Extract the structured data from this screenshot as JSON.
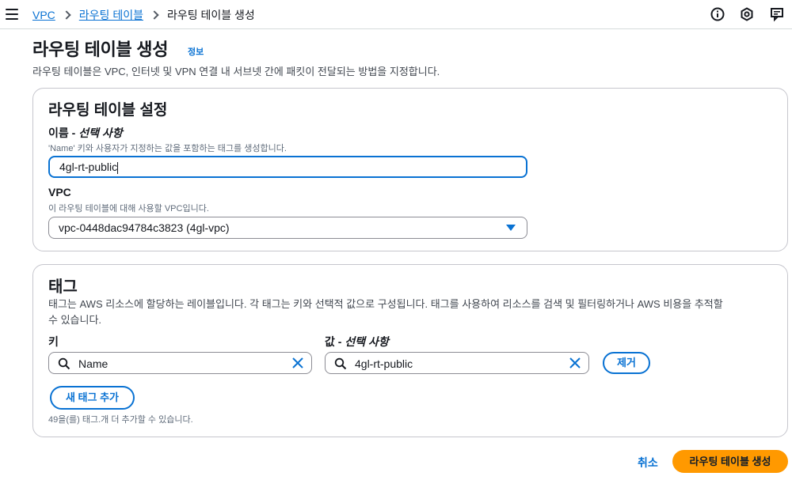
{
  "nav": {
    "breadcrumbs": [
      "VPC",
      "라우팅 테이블",
      "라우팅 테이블 생성"
    ]
  },
  "header": {
    "title": "라우팅 테이블 생성",
    "info": "정보",
    "description": "라우팅 테이블은 VPC, 인터넷 및 VPN 연결 내 서브넷 간에 패킷이 전달되는 방법을 지정합니다."
  },
  "settings": {
    "title": "라우팅 테이블 설정",
    "name_label": "이름 - ",
    "name_optional": "선택 사항",
    "name_desc": "'Name' 키와 사용자가 지정하는 값을 포함하는 태그를 생성합니다.",
    "name_value": "4gl-rt-public",
    "vpc_label": "VPC",
    "vpc_desc": "이 라우팅 테이블에 대해 사용할 VPC입니다.",
    "vpc_selected": "vpc-0448dac94784c3823 (4gl-vpc)"
  },
  "tags": {
    "title": "태그",
    "desc_line1": "태그는 AWS 리소스에 할당하는 레이블입니다. 각 태그는 키와 선택적 값으로 구성됩니다. 태그를 사용하여 리소스를 검색 및 필터링하거나 AWS 비용을 추적할",
    "desc_line2": "수 있습니다.",
    "key_label": "키",
    "value_label": "값 - ",
    "value_optional": "선택 사항",
    "key_value": "Name",
    "tag_value": "4gl-rt-public",
    "remove_label": "제거",
    "add_label": "새 태그 추가",
    "limit_text": "49을(를) 태그.개 더 추가할 수 있습니다."
  },
  "footer": {
    "cancel_label": "취소",
    "create_label": "라우팅 테이블 생성"
  },
  "colors": {
    "link": "#0972d3",
    "primary": "#ff9900",
    "text": "#16191f"
  }
}
